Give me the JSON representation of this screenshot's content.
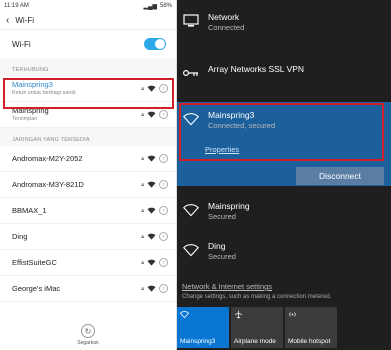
{
  "phone": {
    "statusbar": {
      "time": "11:19 AM",
      "battery": "58%"
    },
    "appbar_title": "Wi-Fi",
    "wifi_toggle_label": "Wi-Fi",
    "section_connected": "TERHUBUNG",
    "section_available": "JARINGAN YANG TERSEDIA",
    "networks_connected": [
      {
        "name": "Mainspring3",
        "sub": "Ketuk untuk berbagi sandi"
      },
      {
        "name": "Mainspring",
        "sub": "Tersimpan"
      }
    ],
    "networks_available": [
      {
        "name": "Andromax-M2Y-2052"
      },
      {
        "name": "Andromax-M3Y-821D"
      },
      {
        "name": "BBMAX_1"
      },
      {
        "name": "Ding"
      },
      {
        "name": "EffistSuiteGC"
      },
      {
        "name": "George's iMac"
      }
    ],
    "refresh_label": "Segarkan"
  },
  "flyout": {
    "network": {
      "title": "Network",
      "sub": "Connected"
    },
    "vpn": {
      "title": "Array Networks SSL VPN"
    },
    "selected": {
      "title": "Mainspring3",
      "sub": "Connected, secured",
      "properties": "Properties"
    },
    "disconnect_label": "Disconnect",
    "others": [
      {
        "title": "Mainspring",
        "sub": "Secured"
      },
      {
        "title": "Ding",
        "sub": "Secured"
      }
    ],
    "settings_link": "Network & Internet settings",
    "settings_desc": "Change settings, such as making a connection metered.",
    "tiles": [
      {
        "label": "Mainspring3",
        "icon": "wifi-icon",
        "active": true
      },
      {
        "label": "Airplane mode",
        "icon": "airplane-icon",
        "active": false
      },
      {
        "label": "Mobile hotspot",
        "icon": "hotspot-icon",
        "active": false
      }
    ]
  },
  "colors": {
    "accent_android": "#2fa8e8",
    "selected_bg": "#1b5f9b",
    "highlight": "#d0202a",
    "tile_active": "#0a76d4"
  }
}
